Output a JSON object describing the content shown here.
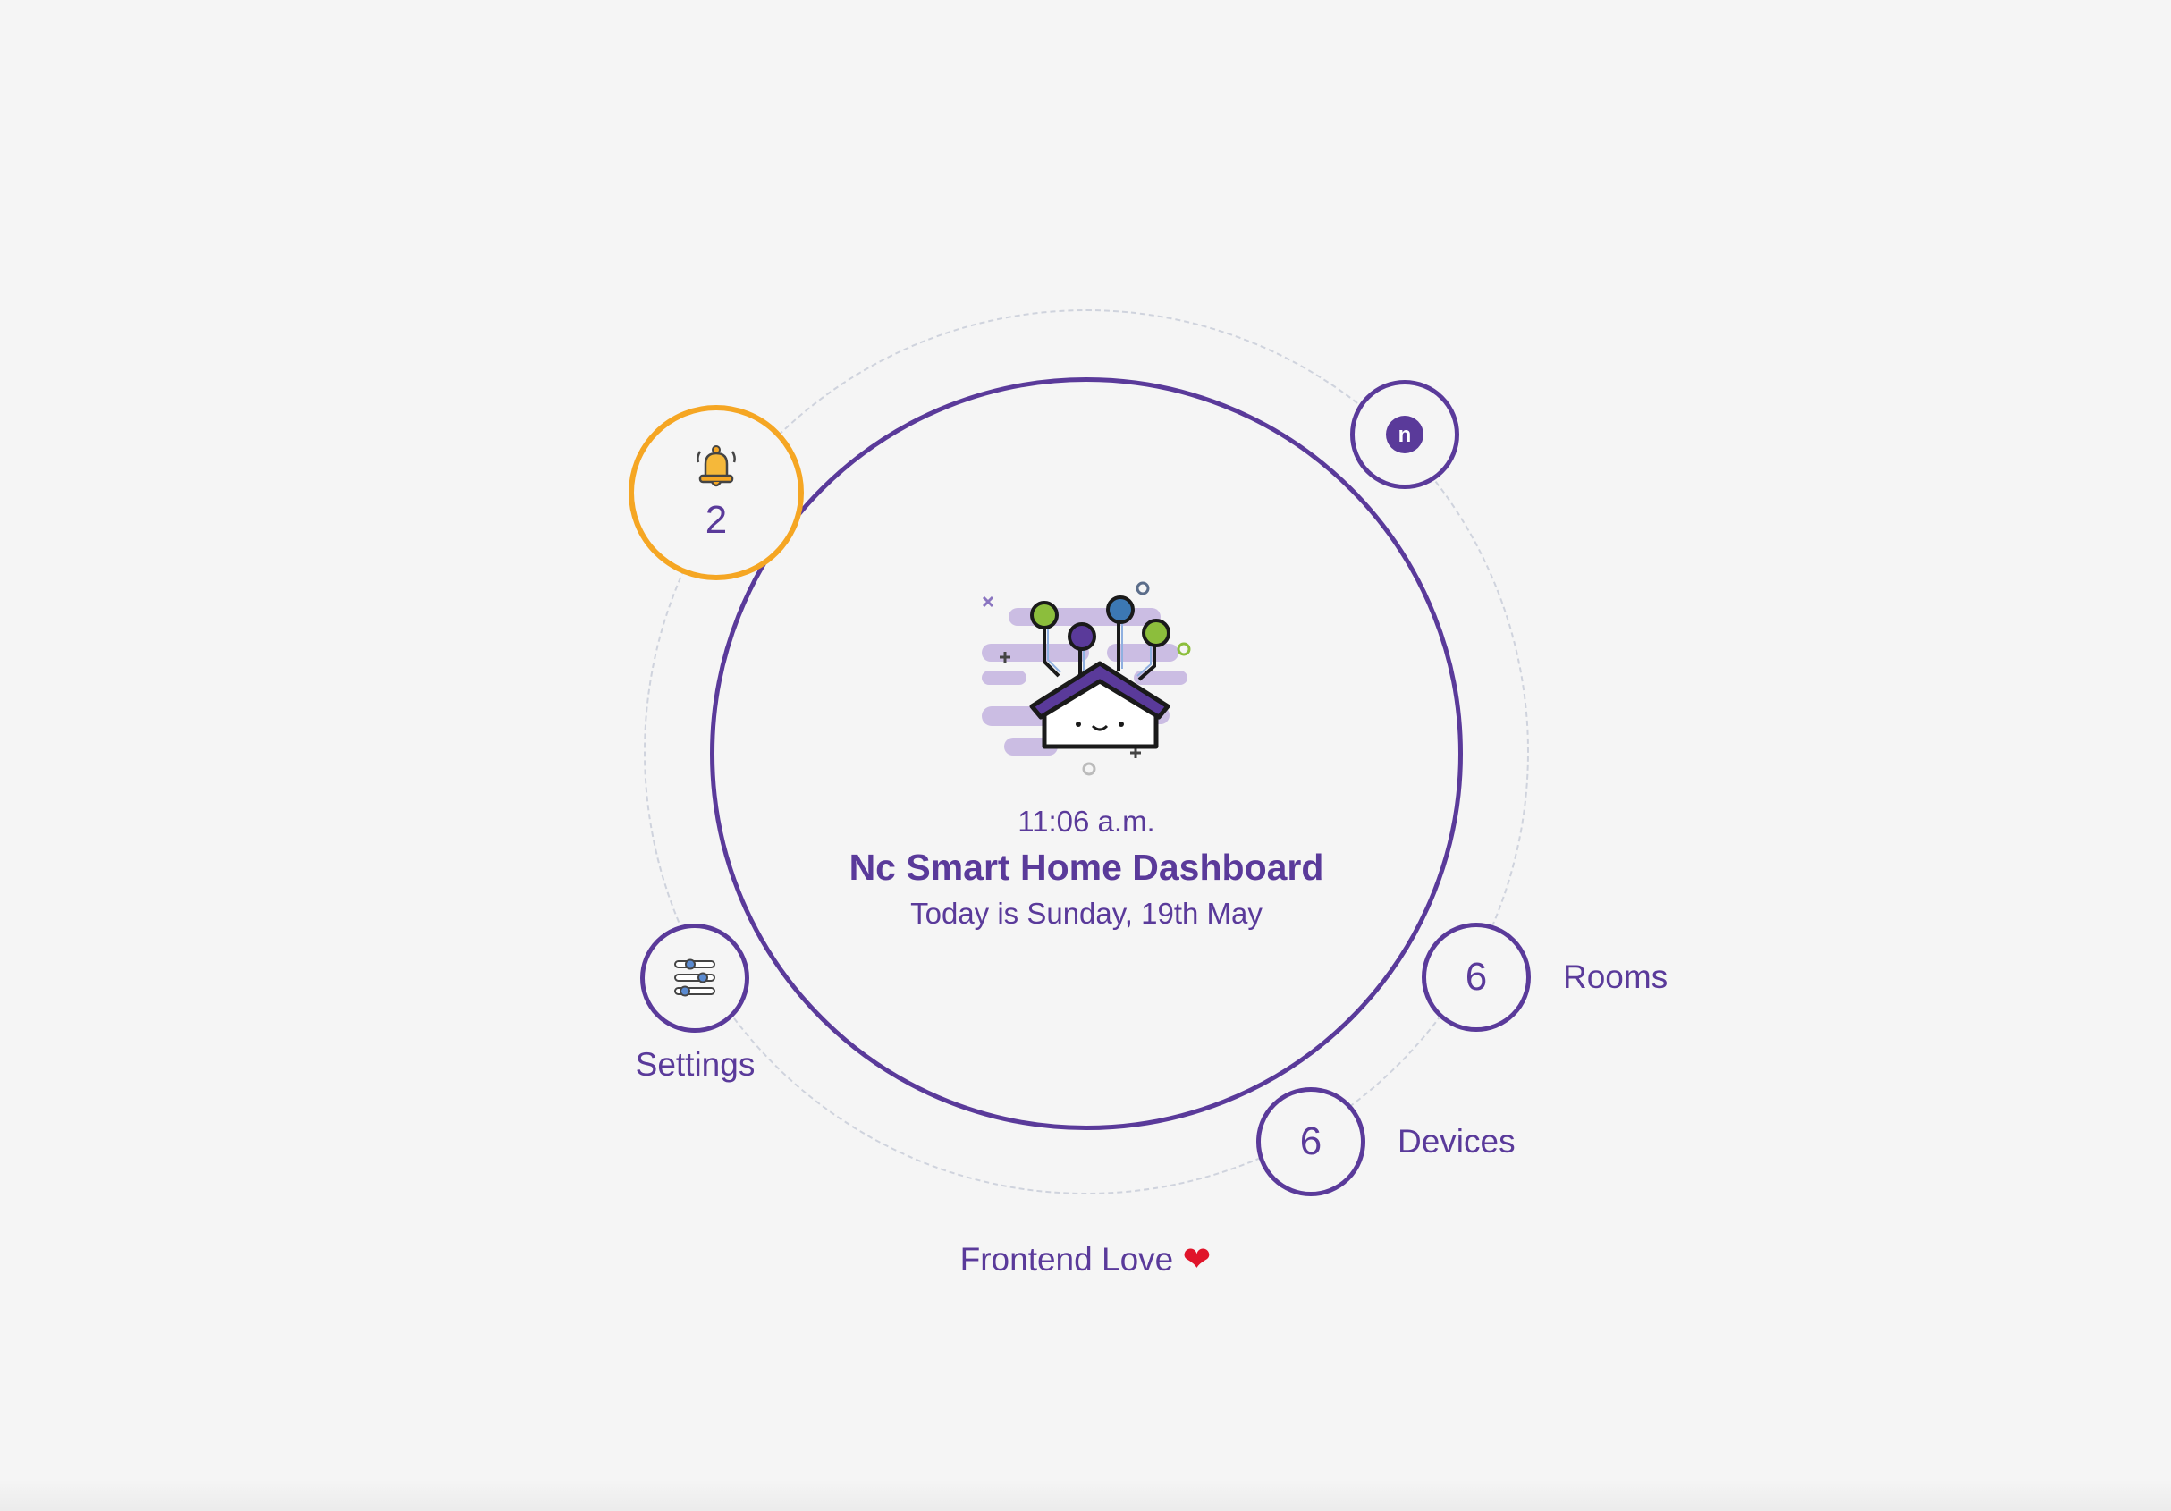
{
  "dashboard": {
    "time": "11:06 a.m.",
    "title": "Nc Smart Home Dashboard",
    "date": "Today is Sunday, 19th May"
  },
  "notifications": {
    "count": "2",
    "icon": "bell-icon"
  },
  "profile": {
    "icon": "nc-logo-icon",
    "initial": "n"
  },
  "settings": {
    "label": "Settings",
    "icon": "sliders-icon"
  },
  "rooms": {
    "count": "6",
    "label": "Rooms"
  },
  "devices": {
    "count": "6",
    "label": "Devices"
  },
  "footer": {
    "text": "Frontend Love",
    "heart": "❤"
  },
  "colors": {
    "primary": "#5a3a9a",
    "accent": "#f5a623",
    "background": "#f5f5f5",
    "heart": "#e0142a"
  }
}
